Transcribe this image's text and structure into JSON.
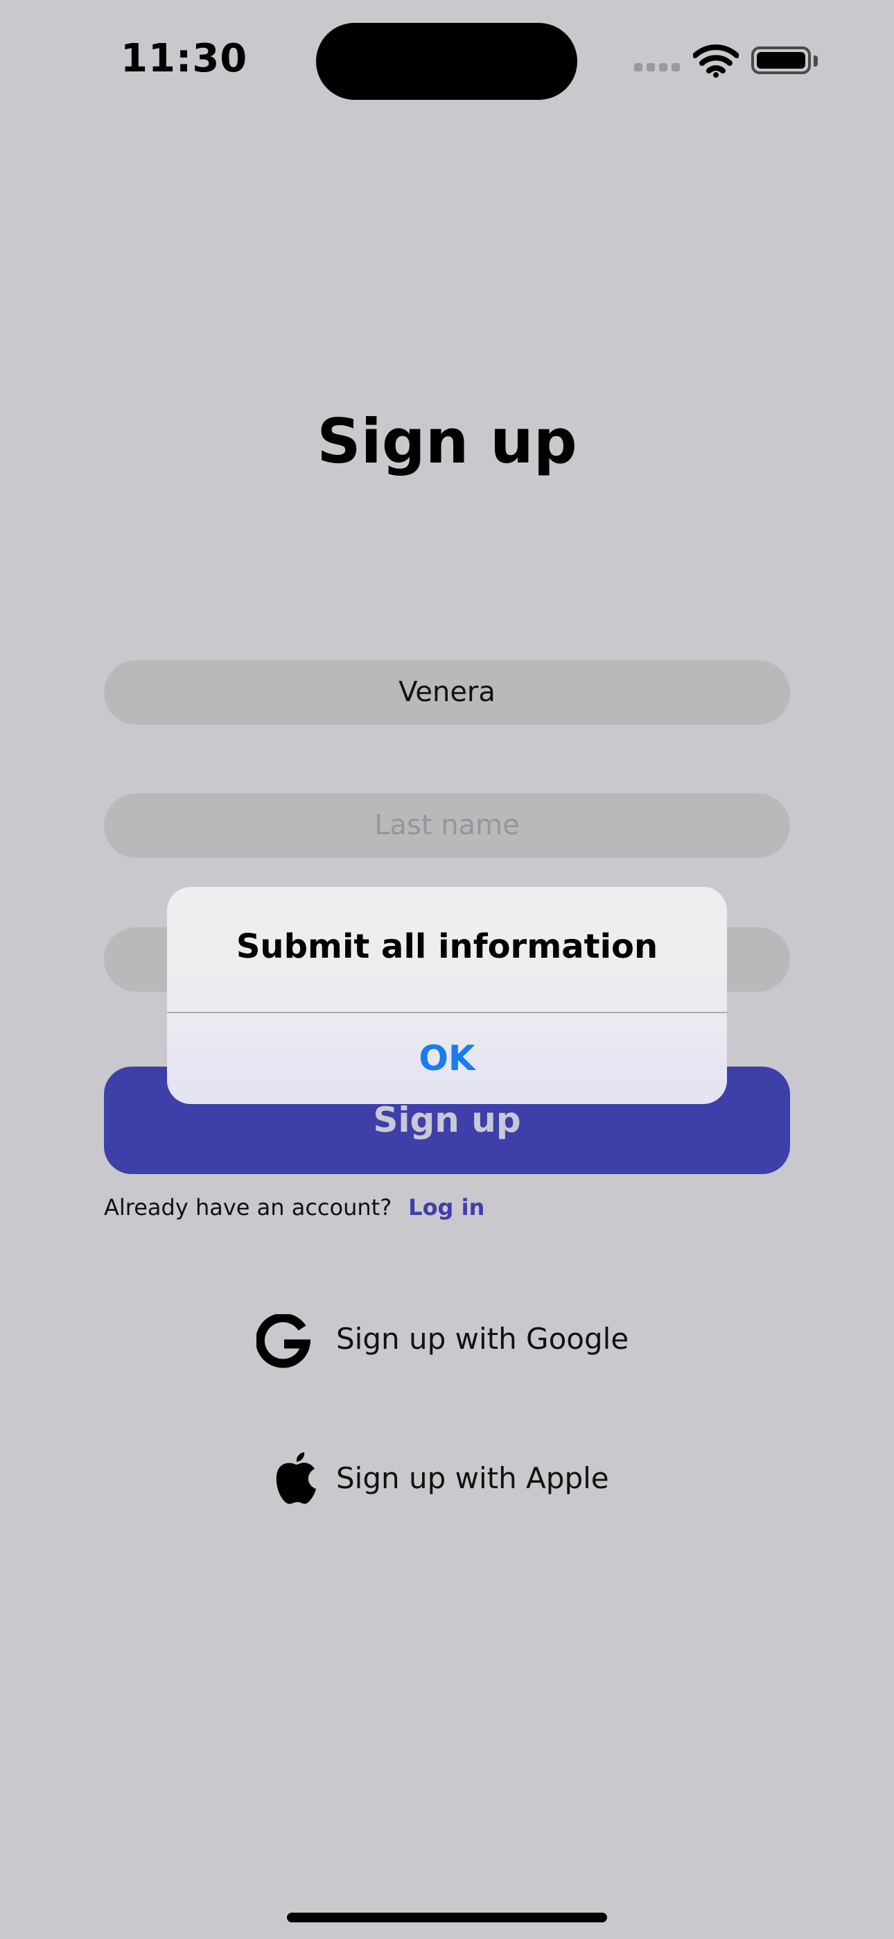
{
  "status_bar": {
    "time": "11:30"
  },
  "page": {
    "title": "Sign up"
  },
  "form": {
    "first_name": {
      "value": "Venera"
    },
    "last_name": {
      "value": "",
      "placeholder": "Last name"
    },
    "third_field": {
      "value": "",
      "placeholder": ""
    },
    "submit_label": "Sign up"
  },
  "account": {
    "question": "Already have an account?",
    "login_label": "Log in"
  },
  "social": {
    "google_label": "Sign up with Google",
    "apple_label": "Sign up with Apple"
  },
  "alert": {
    "title": "Submit all information",
    "ok_label": "OK"
  },
  "colors": {
    "background": "#c9c8cd",
    "accent": "#3e3fa8",
    "alert_action": "#1a7cf1"
  },
  "icons": [
    "wifi-icon",
    "battery-icon",
    "google-icon",
    "apple-icon"
  ]
}
